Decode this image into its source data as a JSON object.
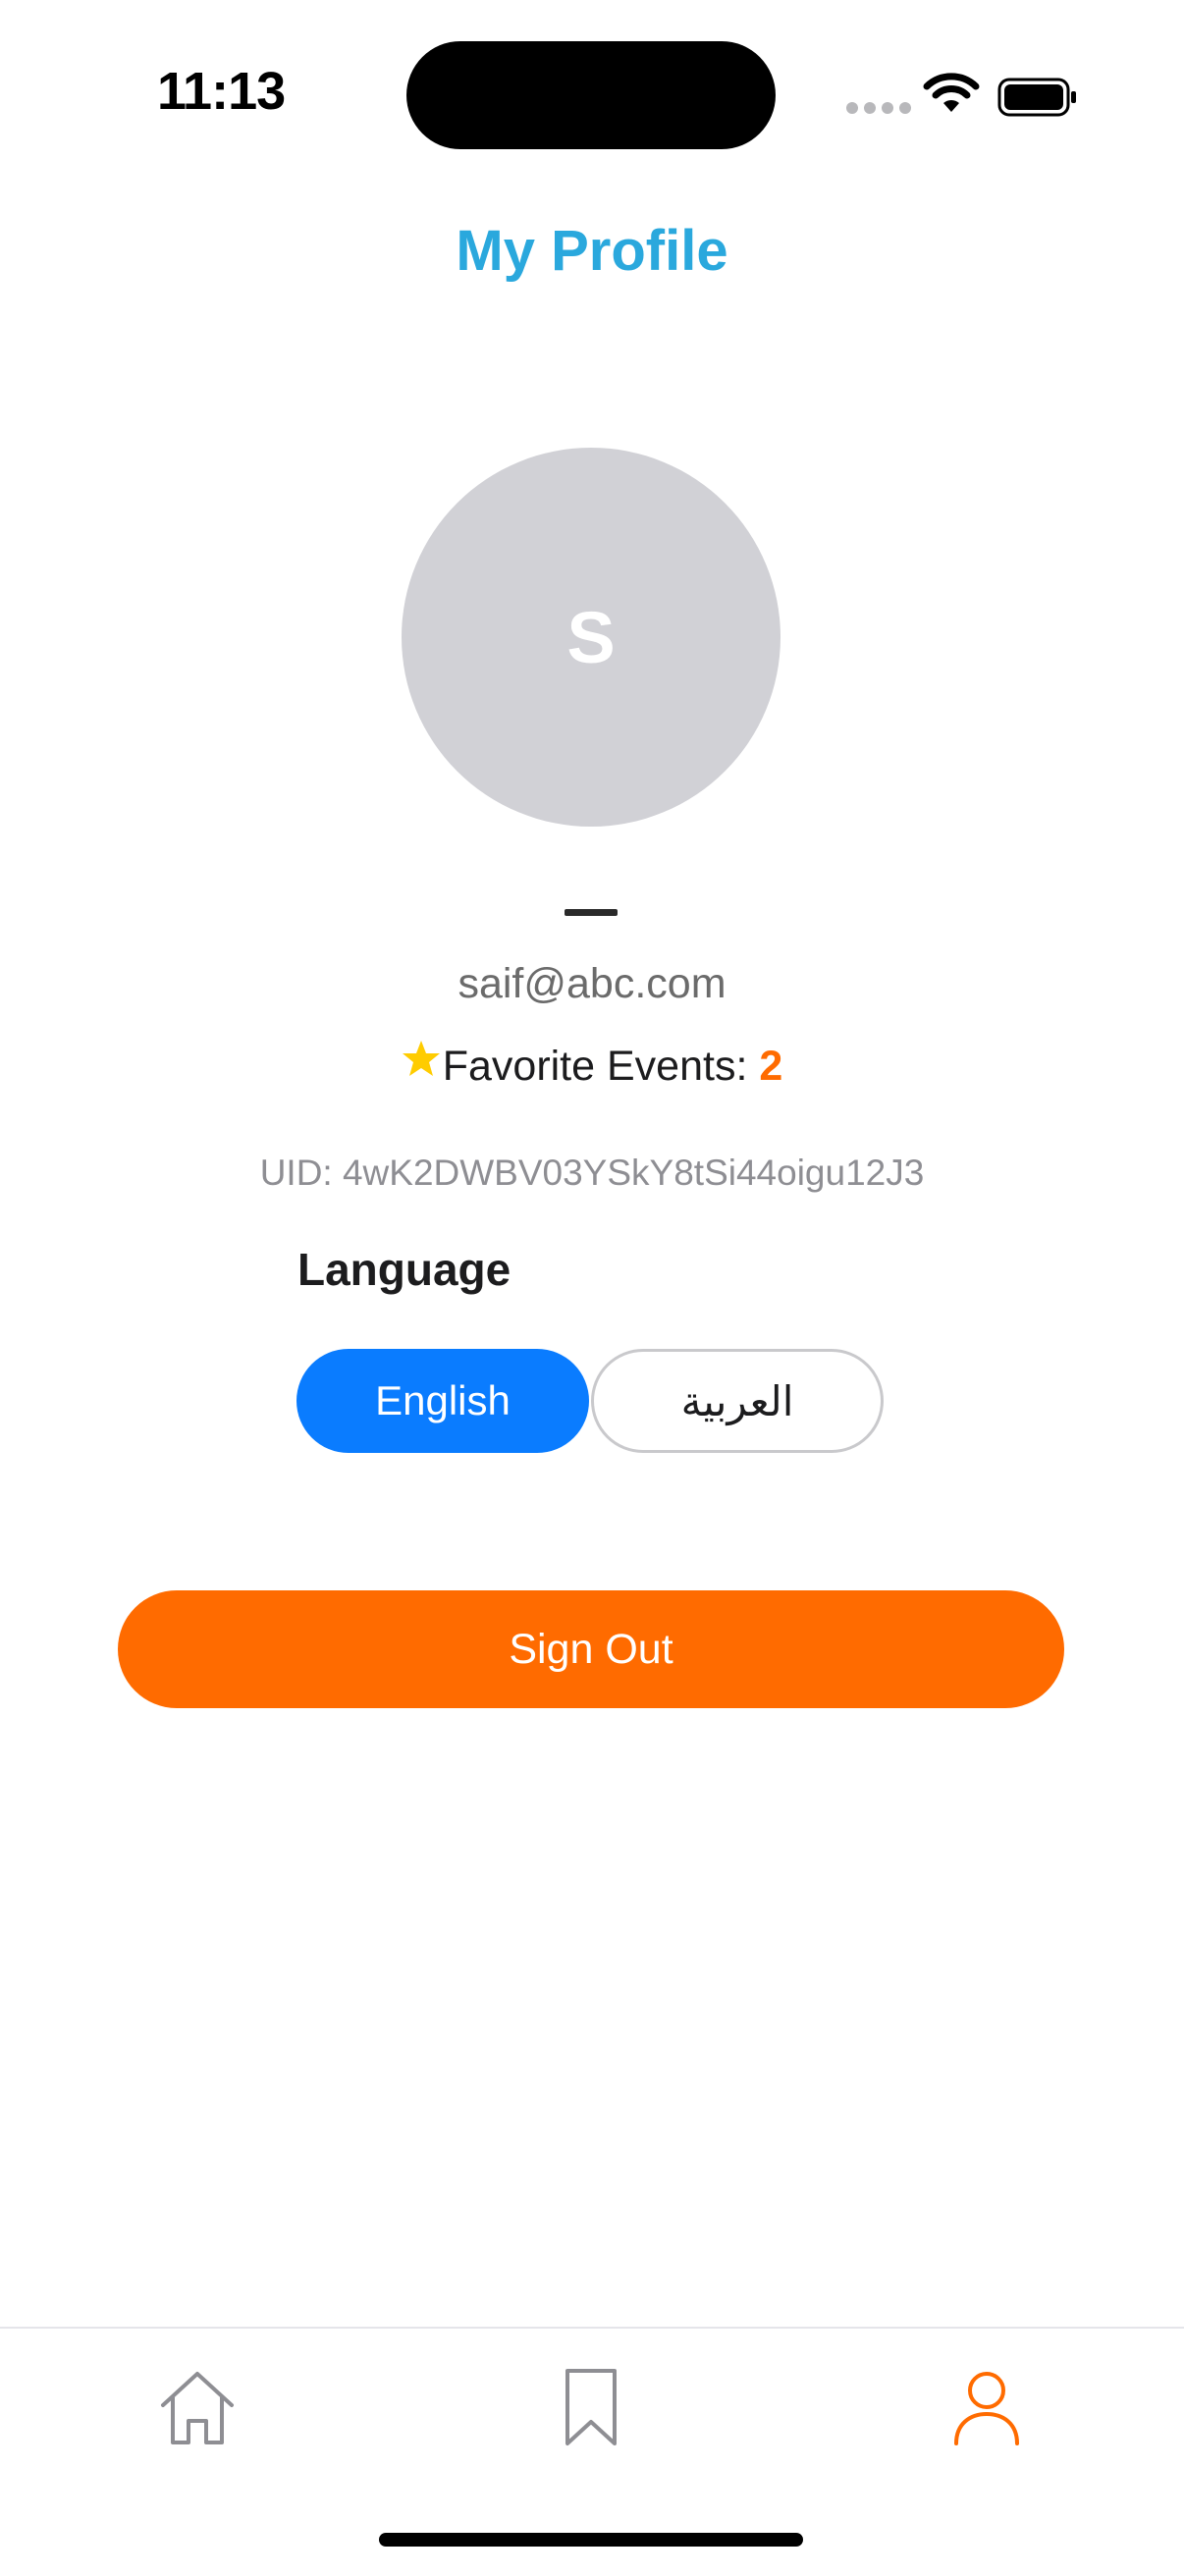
{
  "status_bar": {
    "time": "11:13",
    "icons": [
      "signal-icon",
      "wifi-icon",
      "battery-icon"
    ]
  },
  "header": {
    "title": "My Profile"
  },
  "profile": {
    "avatar_initial": "S",
    "email": "saif@abc.com",
    "favorites_label": "Favorite Events: ",
    "favorites_count": "2",
    "uid": "UID: 4wK2DWBV03YSkY8tSi44oigu12J3"
  },
  "language": {
    "title": "Language",
    "options": [
      "English",
      "العربية"
    ],
    "selected": "English"
  },
  "actions": {
    "sign_out_label": "Sign Out"
  },
  "tab_bar": {
    "tabs": [
      "home-icon",
      "bookmark-icon",
      "person-icon"
    ],
    "active": "person-icon"
  },
  "colors": {
    "title": "#2aa8dd",
    "accent": "#ff6b00",
    "selected_language": "#0a7cff",
    "avatar_bg": "#d1d1d6",
    "star": "#ffcc00",
    "tab_inactive": "#8e8e93"
  }
}
